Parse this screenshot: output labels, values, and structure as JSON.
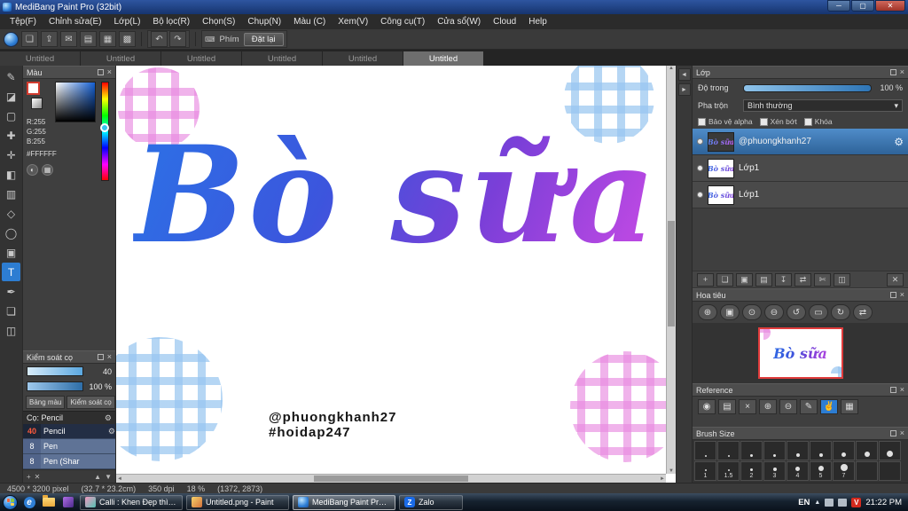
{
  "ui": {
    "close": "×",
    "gear": "⚙",
    "dropdown": "▾",
    "wheel": "◐",
    "grid": "▦",
    "keyboard": "⌨",
    "plus": "+",
    "trash": "✕",
    "up": "▲",
    "down": "▼",
    "left": "◄",
    "right": "►"
  },
  "window": {
    "title": "MediBang Paint Pro (32bit)",
    "controls": {
      "minimize": "─",
      "maximize": "▢",
      "close": "✕"
    }
  },
  "menu": {
    "items": [
      "Tệp(F)",
      "Chỉnh sửa(E)",
      "Lớp(L)",
      "Bộ lọc(R)",
      "Chọn(S)",
      "Chụp(N)",
      "Màu (C)",
      "Xem(V)",
      "Công cụ(T)",
      "Cửa sổ(W)",
      "Cloud",
      "Help"
    ]
  },
  "toolbar": {
    "button_glyphs": [
      "❏",
      "⇪",
      "✉",
      "▤",
      "▦",
      "▩"
    ],
    "undo": "↶",
    "redo": "↷",
    "keys_label": "Phím",
    "reset_button": "Đặt lại"
  },
  "tabs": {
    "labels": [
      "Untitled",
      "Untitled",
      "Untitled",
      "Untitled",
      "Untitled",
      "Untitled"
    ]
  },
  "toolstrip": {
    "glyphs": [
      "✎",
      "◪",
      "▢",
      "✚",
      "✛",
      "◧",
      "▥",
      "◇",
      "◯",
      "▣",
      "T",
      "✒",
      "❏",
      "◫"
    ]
  },
  "left": {
    "color": {
      "title": "Màu",
      "r": "R:255",
      "g": "G:255",
      "b": "B:255",
      "hex": "#FFFFFF"
    },
    "brush_control": {
      "title": "Kiểm soát cọ",
      "size_value": "40",
      "opacity_value": "100 %"
    },
    "tabs": [
      "Bảng màu",
      "Kiểm soát cọ"
    ],
    "brush_list": {
      "header": "Cọ: Pencil",
      "items": [
        {
          "size": "40",
          "name": "Pencil"
        },
        {
          "size": "8",
          "name": "Pen"
        },
        {
          "size": "8",
          "name": "Pen (Shar"
        }
      ]
    }
  },
  "canvas": {
    "artwork_text": "Bò sữa",
    "credit_line1": "@phuongkhanh27",
    "credit_line2": "#hoidap247"
  },
  "layers": {
    "title": "Lớp",
    "opacity_label": "Độ trong",
    "opacity_value": "100 %",
    "blend_label": "Pha trộn",
    "blend_value": "Bình thường",
    "checkboxes": [
      "Bảo vệ alpha",
      "Xén bớt",
      "Khóa"
    ],
    "items": [
      {
        "name": "@phuongkhanh27"
      },
      {
        "name": "Lớp1"
      },
      {
        "name": "Lớp1"
      }
    ],
    "button_glyphs": [
      "+",
      "❏",
      "▣",
      "▤",
      "↧",
      "⇄",
      "✄",
      "◫",
      "✕"
    ]
  },
  "navigator": {
    "title": "Hoa tiêu",
    "button_glyphs": [
      "⊕",
      "▣",
      "⊙",
      "⊖",
      "↺",
      "▭",
      "↻",
      "⇄"
    ]
  },
  "reference": {
    "title": "Reference",
    "button_glyphs": [
      "◉",
      "▤",
      "×",
      "⊕",
      "⊖",
      "✎",
      "✌",
      "▦"
    ]
  },
  "brush_size": {
    "title": "Brush Size",
    "labels": [
      "1",
      "1.5",
      "2",
      "3",
      "4",
      "5",
      "7"
    ]
  },
  "status": {
    "dimensions": "4500 * 3200 pixel",
    "size_cm": "(32.7 * 23.2cm)",
    "dpi": "350 dpi",
    "zoom": "18 %",
    "coords": "(1372, 2873)"
  },
  "taskbar": {
    "buttons": [
      {
        "label": "Calli : Khen Đẹp thì h..."
      },
      {
        "label": "Untitled.png - Paint"
      },
      {
        "label": "MediBang Paint Pro ..."
      },
      {
        "label": "Zalo"
      }
    ],
    "tray": {
      "lang": "EN",
      "caret": "▲",
      "v_badge": "V",
      "time": "21:22 PM"
    }
  },
  "dock": {
    "collapse_glyphs": [
      "◄",
      "►"
    ]
  }
}
